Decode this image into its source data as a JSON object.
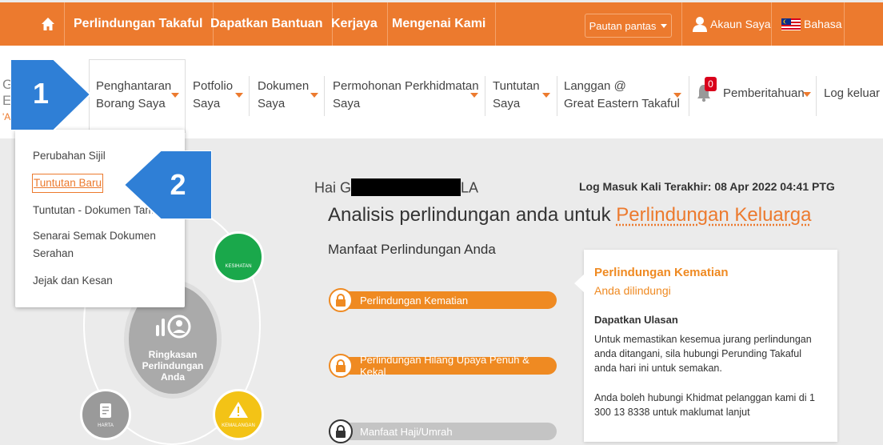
{
  "topbar": {
    "items": [
      "Perlindungan Takaful",
      "Dapatkan Bantuan",
      "Kerjaya",
      "Mengenai Kami"
    ],
    "quick_links": "Pautan pantas",
    "account": "Akaun Saya",
    "language": "Bahasa"
  },
  "logo_fragment": {
    "line1": "G",
    "line2": "E",
    "line3": "'A"
  },
  "nav": {
    "items": [
      {
        "line1": "Penghantaran",
        "line2": "Borang Saya"
      },
      {
        "line1": "Potfolio",
        "line2": "Saya"
      },
      {
        "line1": "Dokumen",
        "line2": "Saya"
      },
      {
        "line1": "Permohonan Perkhidmatan",
        "line2": "Saya"
      },
      {
        "line1": "Tuntutan",
        "line2": "Saya"
      },
      {
        "line1": "Langgan @",
        "line2": "Great Eastern Takaful"
      }
    ],
    "notif_count": "0",
    "notifications": "Pemberitahuan",
    "logout": "Log keluar"
  },
  "dropdown": {
    "items": [
      "Perubahan Sijil",
      "Tuntutan Baru",
      "Tuntutan - Dokumen Tambahan",
      "Senarai Semak Dokumen Serahan",
      "Jejak dan Kesan"
    ]
  },
  "callouts": {
    "step1": "1",
    "step2": "2"
  },
  "greeting": {
    "prefix": "Hai G",
    "suffix": "LA"
  },
  "last_login": "Log Masuk Kali Terakhir: 08 Apr 2022 04:41 PTG",
  "analysis": {
    "text": "Analisis perlindungan anda untuk ",
    "link": "Perlindungan Keluarga"
  },
  "benefits_title": "Manfaat Perlindungan Anda",
  "bars": [
    "Perlindungan Kematian",
    "Perlindungan Hilang Upaya Penuh & Kekal",
    "Manfaat Haji/Umrah"
  ],
  "circles": {
    "center": [
      "Ringkasan",
      "Perlindungan",
      "Anda"
    ],
    "health": "KESIHATAN",
    "property": "HARTA",
    "accident": "KEMALANGAN"
  },
  "card": {
    "title": "Perlindungan Kematian",
    "status": "Anda dilindungi",
    "subheading": "Dapatkan Ulasan",
    "para1": "Untuk memastikan kesemua jurang perlindungan anda ditangani, sila hubungi Perunding Takaful anda hari ini untuk semakan.",
    "para2": "Anda boleh hubungi Khidmat pelanggan kami di 1 300 13 8338 untuk maklumat lanjut"
  },
  "colors": {
    "brand": "#ec7a2e",
    "callout": "#2f7fd6",
    "health": "#1aa84b",
    "accident": "#f3c316",
    "property": "#9a9a9a",
    "badge": "#d9001b"
  },
  "icons": [
    "home-icon",
    "user-icon",
    "flag-icon",
    "bell-icon",
    "lock-icon",
    "moon-icon",
    "warning-icon",
    "document-icon",
    "chart-icon"
  ]
}
